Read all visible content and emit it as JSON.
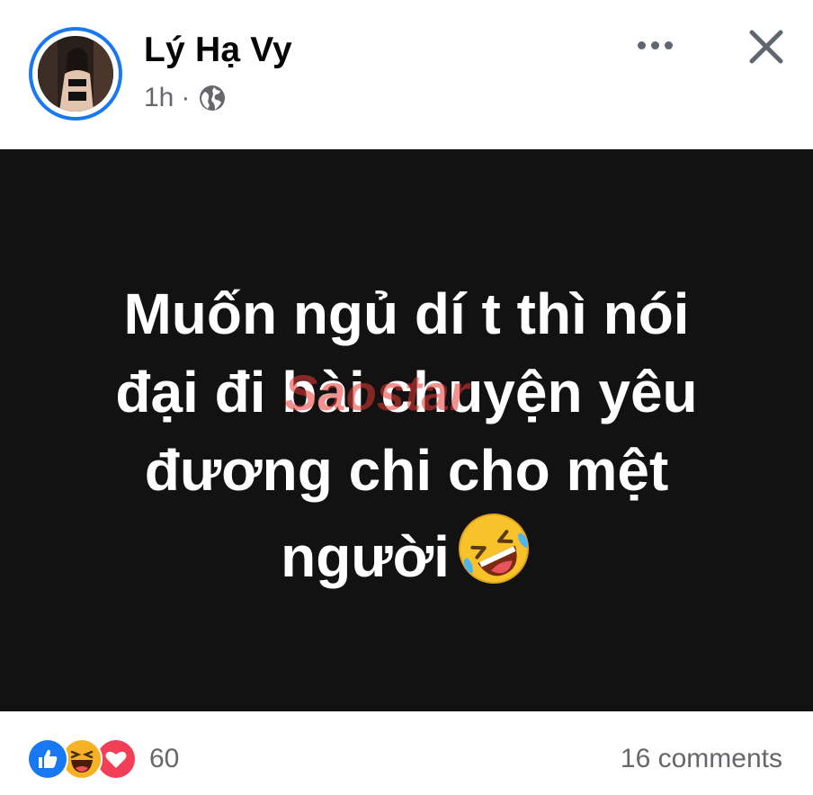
{
  "post": {
    "author_name": "Lý Hạ Vy",
    "time": "1h",
    "separator": "·",
    "privacy_icon": "globe-icon",
    "body_lines": [
      "Muốn ngủ dí t thì nói",
      "đại đi bài chuyện yêu",
      "đương chi cho mệt",
      "người"
    ],
    "emoji": "rolling-on-floor-laughing-emoji",
    "background_color": "#121212",
    "text_color": "#ffffff"
  },
  "watermark": {
    "text": "Saostar"
  },
  "reactions": {
    "icons": [
      "like-icon",
      "haha-icon",
      "love-icon"
    ],
    "count": "60"
  },
  "comments": {
    "label": "16 comments"
  },
  "colors": {
    "accent": "#1877f2",
    "secondary_text": "#65676b",
    "love": "#f33e58",
    "haha": "#f7b125"
  }
}
